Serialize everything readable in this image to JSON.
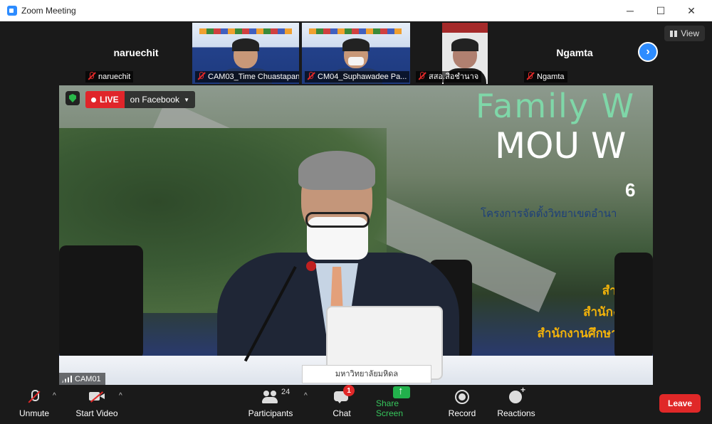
{
  "window": {
    "title": "Zoom Meeting",
    "minimize": "─",
    "maximize": "☐",
    "close": "✕"
  },
  "gallery": {
    "view_label": "View",
    "next_arrow": "›",
    "tiles": [
      {
        "big_name": "naruechit",
        "label": "naruechit"
      },
      {
        "label": "CAM03_Time Chuastapan..."
      },
      {
        "label": "CM04_Suphawadee Pa..."
      },
      {
        "label": "สสอ.สือชำนาจ"
      },
      {
        "big_name": "Ngamta",
        "label": "Ngamta"
      }
    ]
  },
  "main_video": {
    "live_label": "LIVE",
    "live_platform": "on Facebook",
    "camera_label": "CAM01",
    "banner_title": "Family W",
    "banner_mou": "MOU W",
    "banner_number": "6",
    "banner_line1": "โครงการจัดตั้งวิทยาเขตอำนา",
    "banner_line2": "สำนักงาน",
    "banner_line3": "สำนักงานพัฒ",
    "banner_line4": "สำนักงานศึกษาธิการจั",
    "nameplate": "มหาวิทยาลัยมหิดล"
  },
  "toolbar": {
    "unmute": "Unmute",
    "start_video": "Start Video",
    "participants": "Participants",
    "participants_count": "24",
    "chat": "Chat",
    "chat_badge": "1",
    "share_screen": "Share Screen",
    "record": "Record",
    "reactions": "Reactions",
    "leave": "Leave",
    "caret": "^"
  },
  "colors": {
    "accent_blue": "#2d8cff",
    "live_red": "#e0252a",
    "share_green": "#22b14c",
    "leave_red": "#e02828"
  }
}
